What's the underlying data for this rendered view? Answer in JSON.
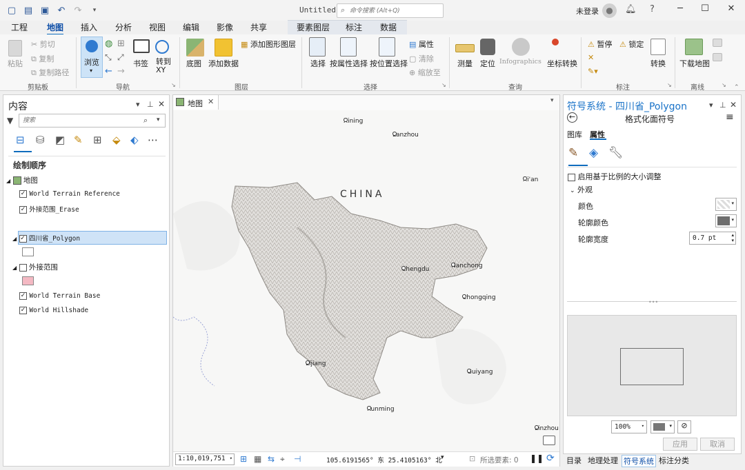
{
  "titlebar": {
    "document_title": "Untitled",
    "command_search_placeholder": "命令搜索 (Alt+Q)",
    "signin": "未登录",
    "help": "?"
  },
  "tabs": [
    "工程",
    "地图",
    "插入",
    "分析",
    "视图",
    "编辑",
    "影像",
    "共享",
    "要素图层",
    "标注",
    "数据"
  ],
  "active_tab": "地图",
  "ribbon": {
    "clipboard": {
      "paste": "粘贴",
      "cut": "剪切",
      "copy": "复制",
      "copy_path": "复制路径",
      "label": "剪贴板"
    },
    "navigate": {
      "explore": "浏览",
      "bookmarks": "书签",
      "goto": "转到\nXY",
      "label": "导航"
    },
    "layer": {
      "basemap": "底图",
      "add_data": "添加数据",
      "add_graphics": "添加图形图层",
      "label": "图层"
    },
    "selection": {
      "select": "选择",
      "by_attr": "按属性选择",
      "by_loc": "按位置选择",
      "attributes": "属性",
      "clear": "清除",
      "zoom_to": "缩放至",
      "label": "选择"
    },
    "inquiry": {
      "measure": "测量",
      "locate": "定位",
      "infographics": "Infographics",
      "convert_coords": "坐标转换",
      "label": "查询"
    },
    "labeling": {
      "pause": "暂停",
      "lock": "锁定",
      "convert": "转换",
      "label": "标注"
    },
    "offline": {
      "download_map": "下载地图",
      "label": "离线"
    }
  },
  "contents": {
    "title": "内容",
    "search_placeholder": "搜索",
    "drawing_order": "绘制顺序",
    "map": "地图",
    "layers": [
      {
        "name": "World Terrain Reference",
        "checked": true,
        "mono": true
      },
      {
        "name": "外接范围_Erase",
        "checked": true,
        "mono": true
      },
      {
        "name": "四川省_Polygon",
        "checked": true,
        "mono": true,
        "selected": true
      },
      {
        "name": "外接范围",
        "checked": false,
        "mono": false
      },
      {
        "name": "World Terrain Base",
        "checked": true,
        "mono": true
      },
      {
        "name": "World Hillshade",
        "checked": true,
        "mono": true
      }
    ]
  },
  "map_view": {
    "tab": "地图",
    "country_label": "CHINA",
    "cities": [
      "Xining",
      "Lanzhou",
      "Xi'an",
      "Chengdu",
      "Nanchong",
      "Chongqing",
      "Lijiang",
      "Guiyang",
      "Kunming",
      "Linzhou"
    ],
    "scale": "1:10,019,751",
    "coordinates": "105.6191565° 东 25.4105163° 北",
    "selected_features": "所选要素: 0"
  },
  "symbology": {
    "title": "符号系统 - 四川省_Polygon",
    "subtitle": "格式化面符号",
    "tab_gallery": "图库",
    "tab_properties": "属性",
    "scale_checkbox": "启用基于比例的大小调整",
    "appearance": "外观",
    "color_label": "颜色",
    "outline_color_label": "轮廓颜色",
    "outline_width_label": "轮廓宽度",
    "outline_width_value": "0.7 pt",
    "outline_color_hex": "#6e6e6e",
    "zoom": "100%",
    "apply": "应用",
    "cancel": "取消"
  },
  "bottom_tabs": [
    "目录",
    "地理处理",
    "符号系统",
    "标注分类"
  ],
  "active_bottom_tab": "符号系统",
  "colors": {
    "accent": "#0f6cbd",
    "selected_row": "#cfe3f7",
    "outer_extent_fill": "#f4b9c3"
  }
}
